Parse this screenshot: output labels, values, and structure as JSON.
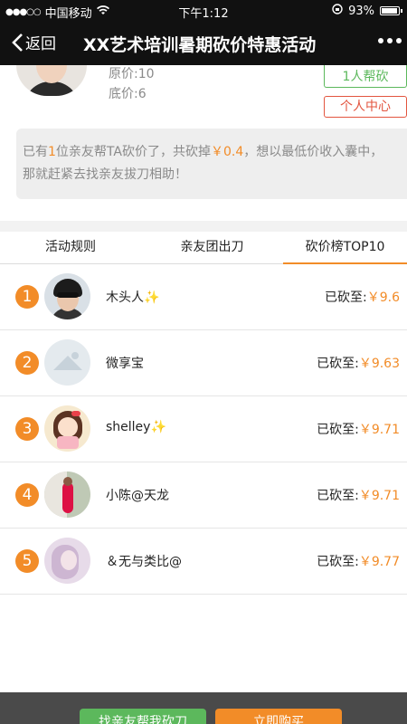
{
  "statusbar": {
    "carrier": "中国移动",
    "time": "下午1:12",
    "battery": "93%",
    "battery_level": 0.93
  },
  "nav": {
    "back_label": "返回",
    "title": "XX艺术培训暑期砍价特惠活动"
  },
  "profile": {
    "original_price": "原价:10",
    "floor_price": "底价:6",
    "helpers_button": "1人帮砍",
    "user_center_button": "个人中心"
  },
  "notice": {
    "part1": "已有",
    "count": "1",
    "part2": "位亲友帮TA砍价了，共砍掉",
    "amount": "￥0.4",
    "part3": "，想以最低价收入囊中，",
    "line2": "那就赶紧去找亲友拔刀相助！"
  },
  "tabs": [
    {
      "label": "活动规则"
    },
    {
      "label": "亲友团出刀"
    },
    {
      "label": "砍价榜TOP10"
    }
  ],
  "ranking": [
    {
      "rank": "1",
      "name": "木头人✨",
      "prefix": "已砍至:",
      "value": "￥9.6"
    },
    {
      "rank": "2",
      "name": "微享宝",
      "prefix": "已砍至:",
      "value": "￥9.63"
    },
    {
      "rank": "3",
      "name": "shelley✨",
      "prefix": "已砍至:",
      "value": "￥9.71"
    },
    {
      "rank": "4",
      "name": "小陈@天龙",
      "prefix": "已砍至:",
      "value": "￥9.71"
    },
    {
      "rank": "5",
      "name": "＆无与类比@",
      "prefix": "已砍至:",
      "value": "￥9.77"
    }
  ],
  "bottom": {
    "help_button": "找亲友帮我砍刀",
    "buy_button": "立即购买"
  },
  "colors": {
    "accent": "#f28c28",
    "green": "#5cb85c",
    "red": "#e3553f",
    "navbar": "#111111"
  }
}
